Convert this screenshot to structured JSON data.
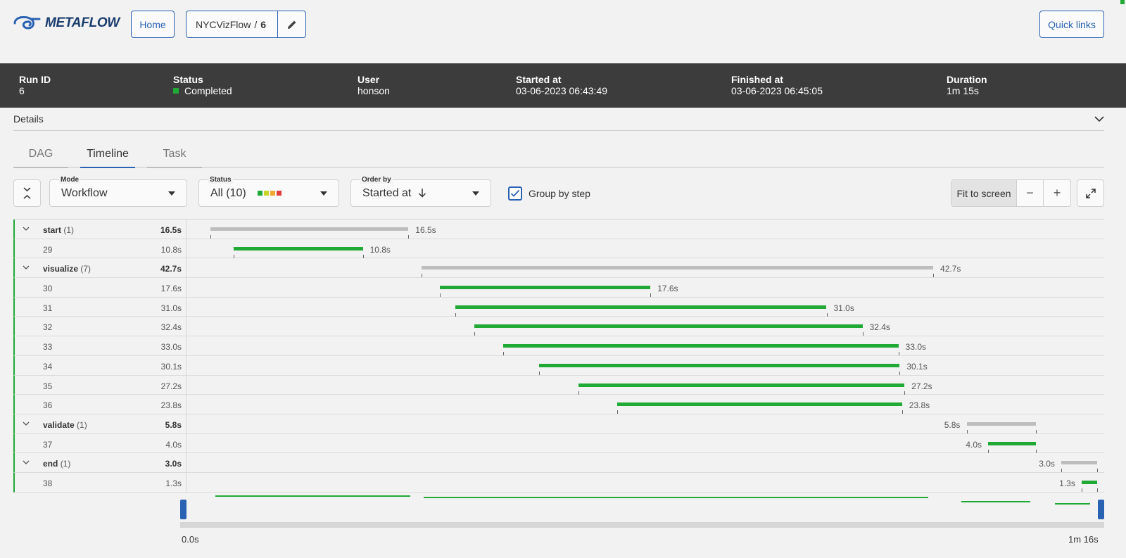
{
  "app": {
    "logo_text": "METAFLOW"
  },
  "nav": {
    "home_label": "Home",
    "flow_name": "NYCVizFlow",
    "separator": "/",
    "run_number": "6",
    "quick_links_label": "Quick links"
  },
  "run": {
    "run_id_label": "Run ID",
    "run_id": "6",
    "status_label": "Status",
    "status": "Completed",
    "user_label": "User",
    "user": "honson",
    "started_label": "Started at",
    "started": "03-06-2023 06:43:49",
    "finished_label": "Finished at",
    "finished": "03-06-2023 06:45:05",
    "duration_label": "Duration",
    "duration": "1m 15s"
  },
  "details_label": "Details",
  "tabs": [
    {
      "label": "DAG"
    },
    {
      "label": "Timeline"
    },
    {
      "label": "Task"
    }
  ],
  "controls": {
    "mode_label": "Mode",
    "mode_value": "Workflow",
    "status_label": "Status",
    "status_value": "All (10)",
    "status_colors": [
      "#20a935",
      "#c8d42a",
      "#f2a530",
      "#e03c3c"
    ],
    "order_label": "Order by",
    "order_value": "Started at",
    "group_by_label": "Group by step",
    "group_by_checked": true,
    "fit_label": "Fit to screen",
    "zoom_out": "−",
    "zoom_in": "+"
  },
  "timeline": {
    "total_seconds": 76,
    "rows": [
      {
        "type": "group",
        "name": "start",
        "count": "(1)",
        "duration": "16.5s",
        "start": 1.9,
        "end": 18.4
      },
      {
        "type": "task",
        "id": "29",
        "duration": "10.8s",
        "start": 3.8,
        "end": 14.6
      },
      {
        "type": "group",
        "name": "visualize",
        "count": "(7)",
        "duration": "42.7s",
        "start": 19.5,
        "end": 62.2
      },
      {
        "type": "task",
        "id": "30",
        "duration": "17.6s",
        "start": 21.0,
        "end": 38.6
      },
      {
        "type": "task",
        "id": "31",
        "duration": "31.0s",
        "start": 22.3,
        "end": 53.3
      },
      {
        "type": "task",
        "id": "32",
        "duration": "32.4s",
        "start": 23.9,
        "end": 56.3
      },
      {
        "type": "task",
        "id": "33",
        "duration": "33.0s",
        "start": 26.3,
        "end": 59.3
      },
      {
        "type": "task",
        "id": "34",
        "duration": "30.1s",
        "start": 29.3,
        "end": 59.4
      },
      {
        "type": "task",
        "id": "35",
        "duration": "27.2s",
        "start": 32.6,
        "end": 59.8
      },
      {
        "type": "task",
        "id": "36",
        "duration": "23.8s",
        "start": 35.8,
        "end": 59.6
      },
      {
        "type": "group",
        "name": "validate",
        "count": "(1)",
        "duration": "5.8s",
        "start": 65.0,
        "end": 70.8
      },
      {
        "type": "task",
        "id": "37",
        "duration": "4.0s",
        "start": 66.8,
        "end": 70.8
      },
      {
        "type": "group",
        "name": "end",
        "count": "(1)",
        "duration": "3.0s",
        "start": 72.9,
        "end": 75.9
      },
      {
        "type": "task",
        "id": "38",
        "duration": "1.3s",
        "start": 74.6,
        "end": 75.9
      }
    ],
    "axis_start_label": "0.0s",
    "axis_end_label": "1m 16s"
  }
}
